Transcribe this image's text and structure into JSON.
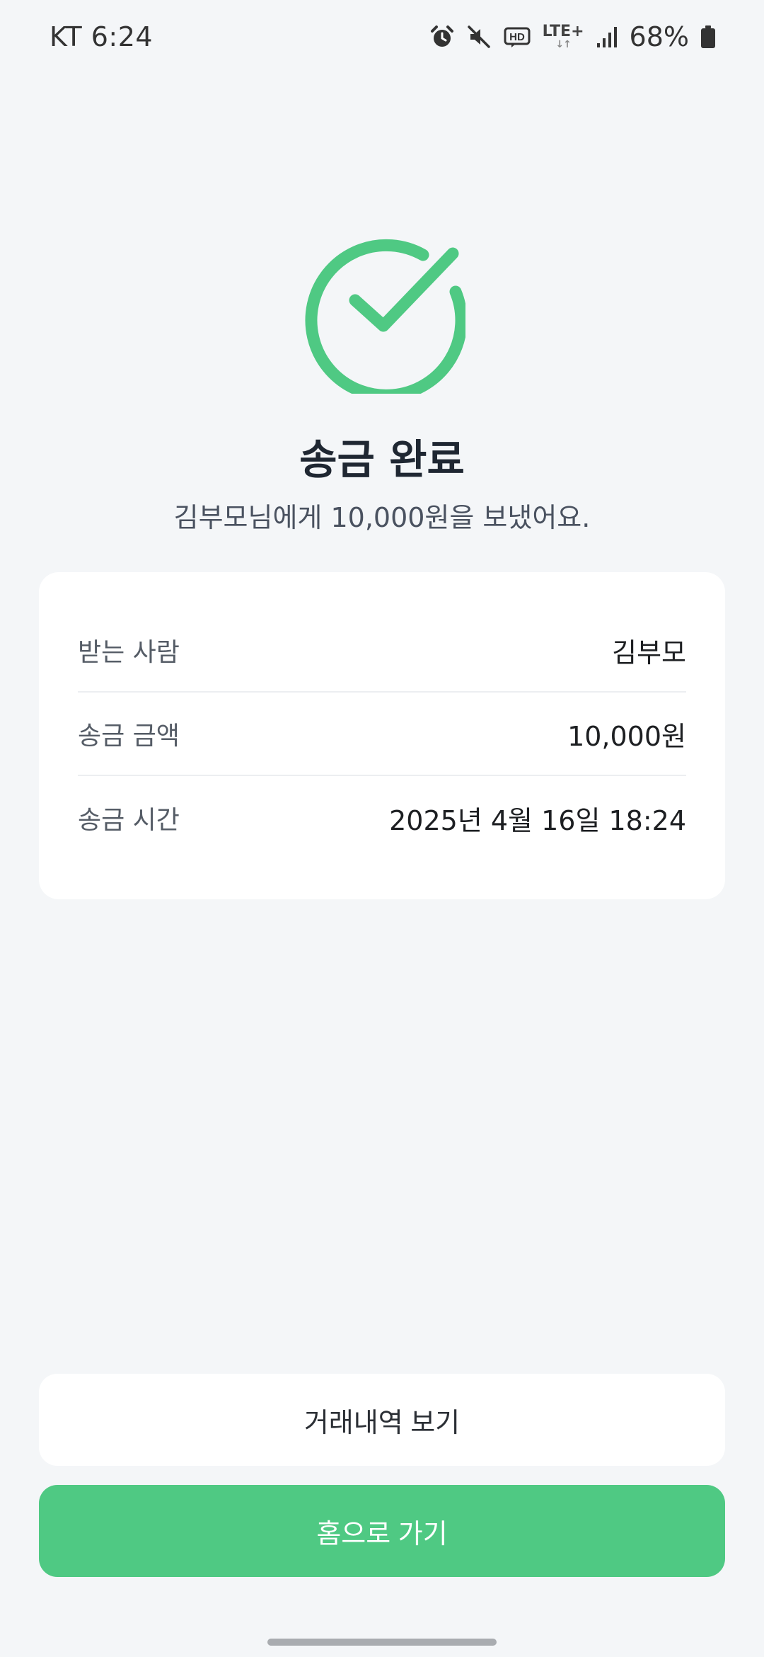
{
  "status_bar": {
    "carrier_time": "KT 6:24",
    "network": "LTE+",
    "network_arrows": "↓↑",
    "battery": "68%",
    "icons": [
      "alarm-icon",
      "mute-icon",
      "hd-voice-icon",
      "lte-plus-icon",
      "signal-icon",
      "battery-icon"
    ]
  },
  "result": {
    "icon": "check-circle-icon",
    "title": "송금 완료",
    "message": "김부모님에게 10,000원을 보냈어요."
  },
  "details": [
    {
      "label": "받는 사람",
      "value": "김부모"
    },
    {
      "label": "송금 금액",
      "value": "10,000원"
    },
    {
      "label": "송금 시간",
      "value": "2025년 4월 16일 18:24"
    }
  ],
  "actions": {
    "history_label": "거래내역 보기",
    "home_label": "홈으로 가기"
  },
  "colors": {
    "accent": "#4fc983",
    "background": "#f4f6f8",
    "card": "#ffffff",
    "title": "#1f2732"
  }
}
